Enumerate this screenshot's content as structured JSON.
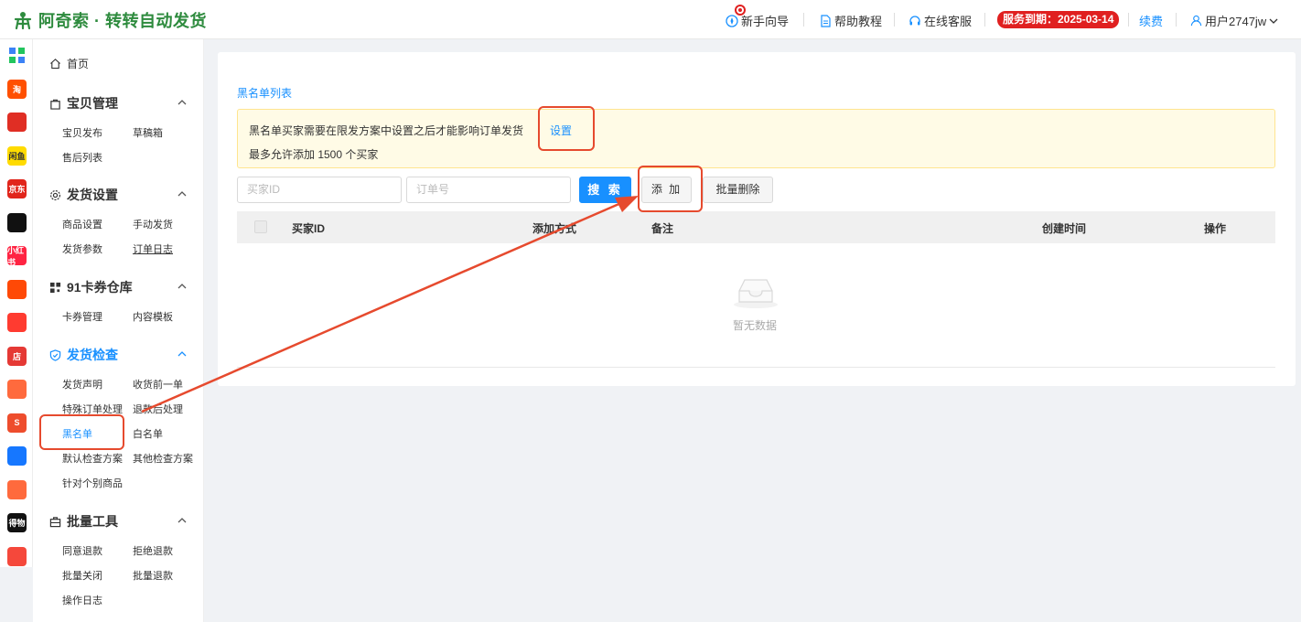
{
  "header": {
    "logo_text": "阿奇索 · 转转自动发货",
    "guide_label": "新手向导",
    "help_label": "帮助教程",
    "service_label": "在线客服",
    "expiry_badge": "服务到期：2025-03-14",
    "renew_label": "续费",
    "user_label": "用户2747jw"
  },
  "platform_icons": [
    {
      "name": "grid-icon",
      "text": "",
      "color": "#3b82f6"
    },
    {
      "name": "taobao-icon",
      "text": "淘",
      "color": "#ff5000"
    },
    {
      "name": "pinduoduo-icon",
      "text": "",
      "color": "#e02e24"
    },
    {
      "name": "xianyu-icon",
      "text": "闲鱼",
      "color": "#ffdb00"
    },
    {
      "name": "jd-icon",
      "text": "京东",
      "color": "#e1251b"
    },
    {
      "name": "douyin-icon",
      "text": "",
      "color": "#111111"
    },
    {
      "name": "xiaohongshu-icon",
      "text": "小红书",
      "color": "#ff2442"
    },
    {
      "name": "kuaishou-icon",
      "text": "",
      "color": "#ff4906"
    },
    {
      "name": "thumbs-icon",
      "text": "",
      "color": "#ff3b30"
    },
    {
      "name": "weidian-icon",
      "text": "店",
      "color": "#e53935"
    },
    {
      "name": "bag-icon",
      "text": "",
      "color": "#ff6a3d"
    },
    {
      "name": "shopee-icon",
      "text": "S",
      "color": "#ee4d2d"
    },
    {
      "name": "link-icon",
      "text": "",
      "color": "#1677ff"
    },
    {
      "name": "chat-icon",
      "text": "",
      "color": "#ff6a3d"
    },
    {
      "name": "dewu-icon",
      "text": "得物",
      "color": "#111111"
    },
    {
      "name": "shield-app-icon",
      "text": "",
      "color": "#f5483b"
    }
  ],
  "sidebar": {
    "home": "首页",
    "groups": [
      {
        "label": "宝贝管理",
        "items": [
          "宝贝发布",
          "草稿箱",
          "售后列表"
        ]
      },
      {
        "label": "发货设置",
        "items": [
          "商品设置",
          "手动发货",
          "发货参数",
          "订单日志"
        ]
      },
      {
        "label": "91卡券仓库",
        "items": [
          "卡券管理",
          "内容模板"
        ]
      },
      {
        "label": "发货检查",
        "items": [
          "发货声明",
          "收货前一单",
          "特殊订单处理",
          "退款后处理",
          "黑名单",
          "白名单",
          "默认检查方案",
          "其他检查方案",
          "针对个别商品"
        ]
      },
      {
        "label": "批量工具",
        "items": [
          "同意退款",
          "拒绝退款",
          "批量关闭",
          "批量退款",
          "操作日志"
        ]
      }
    ]
  },
  "main": {
    "title": "黑名单列表",
    "notice_line1": "黑名单买家需要在限发方案中设置之后才能影响订单发货",
    "notice_link": "设置",
    "notice_line2": "最多允许添加 1500 个买家",
    "buyer_placeholder": "买家ID",
    "order_placeholder": "订单号",
    "search_label": "搜 索",
    "add_label": "添 加",
    "batch_delete_label": "批量删除",
    "columns": [
      "买家ID",
      "添加方式",
      "备注",
      "创建时间",
      "操作"
    ],
    "empty_text": "暂无数据"
  },
  "colors": {
    "accent": "#1890ff",
    "brand": "#2e8b3e",
    "highlight": "#e64a2e"
  }
}
